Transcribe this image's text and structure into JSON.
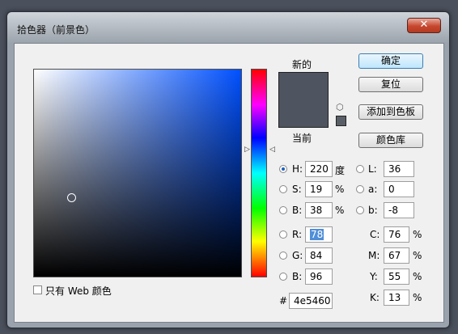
{
  "window": {
    "title": "拾色器（前景色）",
    "close_symbol": "✕"
  },
  "swatches": {
    "new_label": "新的",
    "current_label": "当前",
    "new_color": "#4e5460",
    "current_color": "#4e5460"
  },
  "buttons": {
    "ok": "确定",
    "reset": "复位",
    "add_to_swatches": "添加到色板",
    "color_libraries": "颜色库"
  },
  "hsb": {
    "h": {
      "label": "H:",
      "value": "220",
      "unit": "度"
    },
    "s": {
      "label": "S:",
      "value": "19",
      "unit": "%"
    },
    "b": {
      "label": "B:",
      "value": "38",
      "unit": "%"
    }
  },
  "rgb": {
    "r": {
      "label": "R:",
      "value": "78"
    },
    "g": {
      "label": "G:",
      "value": "84"
    },
    "b": {
      "label": "B:",
      "value": "96"
    }
  },
  "lab": {
    "l": {
      "label": "L:",
      "value": "36"
    },
    "a": {
      "label": "a:",
      "value": "0"
    },
    "b": {
      "label": "b:",
      "value": "-8"
    }
  },
  "cmyk": {
    "c": {
      "label": "C:",
      "value": "76",
      "unit": "%"
    },
    "m": {
      "label": "M:",
      "value": "67",
      "unit": "%"
    },
    "y": {
      "label": "Y:",
      "value": "55",
      "unit": "%"
    },
    "k": {
      "label": "K:",
      "value": "13",
      "unit": "%"
    }
  },
  "hex": {
    "label": "#",
    "value": "4e5460"
  },
  "web_only": {
    "label": "只有 Web 颜色",
    "checked": false
  }
}
